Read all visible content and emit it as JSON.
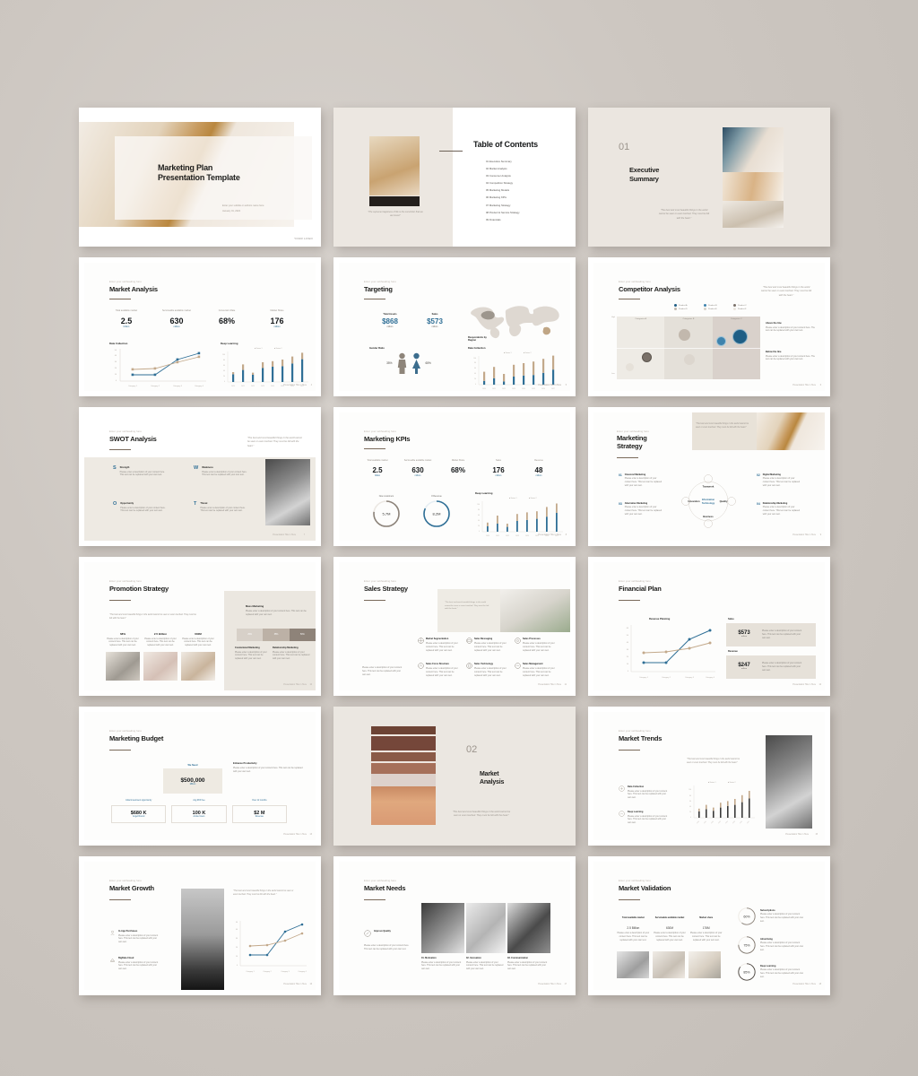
{
  "deck": {
    "eyebrow": "Enter your subheading here",
    "quote": "\"The best and most beautiful things in the world cannot be seen or even touched. They must be felt with the heart.\"",
    "body_placeholder": "Please enter a description of your content here. This text can be replaced with your own text.",
    "footer": "Presentation Title in Here"
  },
  "slides": [
    {
      "id": "cover",
      "title_line1": "Marketing Plan",
      "title_line2": "Presentation Template",
      "subtitle": "Enter your subtitle or authors name here",
      "date": "January 01, 2022",
      "logo": "YOUR LOGO"
    },
    {
      "id": "table-of-contents",
      "title": "Table of Contents",
      "caption": "\"The supreme happiness of life is the conviction that we are loved.\"",
      "items": [
        "01  Executive Summary",
        "02  Market Analysis",
        "03  Consumer Analysis",
        "04  Competition Strategy",
        "05  Marketing Models",
        "06  Marketing KPIs",
        "07  Marketing Strategy",
        "08  Product & Service Strategy",
        "09  Financials"
      ]
    },
    {
      "id": "section-01",
      "number": "01",
      "title_line1": "Executive",
      "title_line2": "Summary"
    },
    {
      "id": "market-analysis",
      "title": "Market Analysis",
      "stats": [
        {
          "label": "Total available market",
          "value": "2.5",
          "unit": "billion"
        },
        {
          "label": "Serviceable available market",
          "value": "630",
          "unit": "million"
        },
        {
          "label": "Conversion Rate",
          "value": "68%",
          "unit": ""
        },
        {
          "label": "Market Share",
          "value": "176",
          "unit": "million"
        }
      ],
      "chart_left_title": "Data Collection",
      "chart_right_title": "Deep Learning",
      "page": "4"
    },
    {
      "id": "targeting",
      "title": "Targeting",
      "stats": [
        {
          "label": "Total Assets",
          "value": "$868",
          "unit": "million"
        },
        {
          "label": "Sales",
          "value": "$573",
          "unit": "million"
        }
      ],
      "gender_label": "Gender Ratio",
      "gender_male": "35%",
      "gender_female": "65%",
      "map_label": "Respondents by Region",
      "chart_title": "Data Collection",
      "page": "5"
    },
    {
      "id": "competitor-analysis",
      "title": "Competitor Analysis",
      "legend": [
        "Product A",
        "Product B",
        "Product C",
        "Product D",
        "Product E",
        "Product F"
      ],
      "columns": [
        "Categories A",
        "Categories B",
        "Categories C"
      ],
      "axis_high": "High",
      "axis_low": "Low",
      "notes": [
        {
          "heading": "Above the line",
          "text": "Please enter a description of your content here. The text can be replaced with your own text."
        },
        {
          "heading": "Below the line",
          "text": "Please enter a description of your content here. The text can be replaced with your own text."
        }
      ],
      "page": "6"
    },
    {
      "id": "swot-analysis",
      "title": "SWOT Analysis",
      "cells": [
        {
          "letter": "S",
          "heading": "Strength"
        },
        {
          "letter": "W",
          "heading": "Weakness"
        },
        {
          "letter": "O",
          "heading": "Opportunity"
        },
        {
          "letter": "T",
          "heading": "Threat"
        }
      ],
      "page": "7"
    },
    {
      "id": "marketing-kpis",
      "title": "Marketing KPIs",
      "stats": [
        {
          "label": "Total available market",
          "value": "2.5",
          "unit": "billion"
        },
        {
          "label": "Serviceable available market",
          "value": "630",
          "unit": "million"
        },
        {
          "label": "Market Share",
          "value": "68%",
          "unit": ""
        },
        {
          "label": "Sales",
          "value": "176",
          "unit": "million"
        },
        {
          "label": "Revenue",
          "value": "48",
          "unit": "million"
        }
      ],
      "donuts": [
        {
          "label": "New customers",
          "value": "5,7M"
        },
        {
          "label": "# Revenue",
          "value": "8,2M"
        }
      ],
      "chart_title": "Deep Learning",
      "page": "8"
    },
    {
      "id": "marketing-strategy",
      "title_line1": "Marketing",
      "title_line2": "Strategy",
      "items": [
        {
          "num": "01",
          "heading": "Classical Marketing"
        },
        {
          "num": "02",
          "heading": "Digital Marketing"
        },
        {
          "num": "03",
          "heading": "Alternative Marketing"
        },
        {
          "num": "04",
          "heading": "Relationship Marketing"
        }
      ],
      "center": "Information Technology",
      "ring": [
        "Teamwork",
        "Quality",
        "Business",
        "Innovation"
      ],
      "page": "9"
    },
    {
      "id": "promotion-strategy",
      "title": "Promotion Strategy",
      "stats": [
        {
          "value": "68%"
        },
        {
          "value": "2.5 Billion"
        },
        {
          "value": "630M"
        }
      ],
      "panel_heading": "Mass Marketing",
      "bars": [
        "25%",
        "35%",
        "50%"
      ],
      "panel_items": [
        "Customized Marketing",
        "Relationship Marketing"
      ],
      "page": "10"
    },
    {
      "id": "sales-strategy",
      "title": "Sales Strategy",
      "items": [
        "Market Segmentation",
        "Sales Messaging",
        "Sales Processes",
        "Sales Force Structure",
        "Sales Technology",
        "Sales Management"
      ],
      "page": "11"
    },
    {
      "id": "financial-plan",
      "title": "Financial Plan",
      "chart_title": "Revenue Planning",
      "cards": [
        {
          "label": "Sales",
          "value": "$573",
          "unit": "million"
        },
        {
          "label": "Revenue",
          "value": "$247",
          "unit": "million"
        }
      ],
      "page": "12"
    },
    {
      "id": "marketing-budget",
      "title": "Marketing Budget",
      "need_label": "We Need",
      "need_value": "$500,000",
      "need_unit": "Million",
      "note_heading": "Enhance Productivity",
      "cards": [
        {
          "label": "Initial investment opportunity",
          "value": "$680 K",
          "unit": "Angel Round"
        },
        {
          "label": "Avg ROI free",
          "value": "100 K",
          "unit": "Active Users"
        },
        {
          "label": "Over 12 months",
          "value": "$2 M",
          "unit": "Revenue"
        }
      ],
      "page": "13"
    },
    {
      "id": "section-02",
      "number": "02",
      "title_line1": "Market",
      "title_line2": "Analysis"
    },
    {
      "id": "market-trends",
      "title": "Market Trends",
      "items": [
        {
          "heading": "Data Collection"
        },
        {
          "heading": "Deep Learning"
        }
      ],
      "legend": [
        "Series 1",
        "Series 2"
      ],
      "page": "15"
    },
    {
      "id": "market-growth",
      "title": "Market Growth",
      "items": [
        {
          "heading": "In-App Purchases"
        },
        {
          "heading": "BigData Cloud"
        }
      ],
      "page": "16"
    },
    {
      "id": "market-needs",
      "title": "Market Needs",
      "side_heading": "Improve Quality",
      "items": [
        "01. Motivation",
        "02. Innovation",
        "03. Communication"
      ],
      "page": "17"
    },
    {
      "id": "market-validation",
      "title": "Market Validation",
      "stats": [
        {
          "label": "Total available market",
          "value": "2.5 Billion"
        },
        {
          "label": "Serviceable available market",
          "value": "630M"
        },
        {
          "label": "Market share",
          "value": "176M"
        }
      ],
      "donuts": [
        {
          "value": "60%",
          "heading": "Subscriptions"
        },
        {
          "value": "75%",
          "heading": "Advertising"
        },
        {
          "value": "85%",
          "heading": "Deep Learning"
        }
      ],
      "page": "18"
    }
  ],
  "chart_data": [
    {
      "type": "line",
      "title": "Data Collection",
      "slide": "market-analysis",
      "categories": [
        "Category 1",
        "Category 2",
        "Category 3",
        "Category 4"
      ],
      "series": [
        {
          "name": "Series 1",
          "values": [
            10,
            10,
            35,
            47
          ],
          "color": "#2f6f96"
        },
        {
          "name": "Series 2",
          "values": [
            18,
            19,
            30,
            38
          ],
          "color": "#c3a98b"
        }
      ],
      "ylim": [
        0,
        50
      ],
      "grid": false
    },
    {
      "type": "bar",
      "title": "Deep Learning",
      "slide": "market-analysis",
      "categories": [
        "2020",
        "2021",
        "2022",
        "2023",
        "2024",
        "2025",
        "2026",
        "2027"
      ],
      "series": [
        {
          "name": "Series 1",
          "values": [
            22,
            38,
            20,
            45,
            50,
            52,
            62,
            78
          ],
          "color": "#2f6f96"
        },
        {
          "name": "Series 2",
          "values": [
            30,
            52,
            28,
            60,
            64,
            70,
            85,
            100
          ],
          "color": "#c3a98b"
        }
      ],
      "ylim": [
        0,
        120
      ],
      "grid": false,
      "legend": "top"
    },
    {
      "type": "bar",
      "title": "Data Collection",
      "slide": "targeting",
      "categories": [
        "2020",
        "2021",
        "2022",
        "2023",
        "2024",
        "2025",
        "2026",
        "2027"
      ],
      "series": [
        {
          "name": "Series 1",
          "values": [
            14,
            24,
            12,
            30,
            34,
            36,
            44,
            56
          ],
          "color": "#2f6f96"
        },
        {
          "name": "Series 2",
          "values": [
            48,
            66,
            40,
            74,
            80,
            86,
            96,
            112
          ],
          "color": "#c3a98b"
        }
      ],
      "ylim": [
        0,
        120
      ],
      "grid": false,
      "legend": "top"
    },
    {
      "type": "scatter",
      "title": "Competitor Analysis Matrix",
      "slide": "competitor-analysis",
      "xlabel": "Low → High",
      "ylabel": "High",
      "points": [
        {
          "name": "Product A",
          "x": 74,
          "y": 66,
          "r": 13,
          "color": "#2a5f82"
        },
        {
          "name": "Product B",
          "x": 62,
          "y": 60,
          "r": 8,
          "color": "#4a86ad"
        },
        {
          "name": "Product C",
          "x": 30,
          "y": 36,
          "r": 7,
          "color": "#8a8075"
        },
        {
          "name": "Product D",
          "x": 38,
          "y": 68,
          "r": 9,
          "color": "#b9afa3"
        },
        {
          "name": "Product E",
          "x": 18,
          "y": 26,
          "r": 7,
          "color": "#e0dbd3"
        },
        {
          "name": "Product F",
          "x": 48,
          "y": 30,
          "r": 8,
          "color": "#ddd7cf"
        }
      ]
    },
    {
      "type": "bar",
      "title": "Deep Learning",
      "slide": "marketing-kpis",
      "categories": [
        "2020",
        "2021",
        "2022",
        "2023",
        "2024",
        "2025",
        "2026",
        "2027"
      ],
      "series": [
        {
          "name": "Series 1",
          "values": [
            20,
            30,
            18,
            40,
            44,
            48,
            56,
            70
          ],
          "color": "#2f6f96"
        },
        {
          "name": "Series 2",
          "values": [
            34,
            60,
            30,
            66,
            72,
            76,
            92,
            105
          ],
          "color": "#c3a98b"
        }
      ],
      "ylim": [
        0,
        120
      ],
      "grid": false,
      "legend": "top"
    },
    {
      "type": "line",
      "title": "Revenue Planning",
      "slide": "financial-plan",
      "categories": [
        "Category 1",
        "Category 2",
        "Category 3",
        "Category 4"
      ],
      "series": [
        {
          "name": "Series 1",
          "values": [
            12,
            12,
            44,
            58
          ],
          "color": "#2f6f96"
        },
        {
          "name": "Series 2",
          "values": [
            26,
            27,
            33,
            42
          ],
          "color": "#c3a98b"
        }
      ],
      "ylim": [
        0,
        70
      ],
      "grid": false
    },
    {
      "type": "bar",
      "title": "Market Trends",
      "slide": "market-trends",
      "categories": [
        "2020",
        "2021",
        "2022",
        "2023",
        "2024",
        "2025",
        "2026",
        "2027"
      ],
      "series": [
        {
          "name": "Series 1",
          "values": [
            24,
            32,
            26,
            38,
            44,
            48,
            58,
            72
          ],
          "color": "#3a3a3a"
        },
        {
          "name": "Series 2",
          "values": [
            34,
            48,
            38,
            56,
            62,
            70,
            84,
            100
          ],
          "color": "#c3a98b"
        }
      ],
      "ylim": [
        0,
        120
      ],
      "grid": false,
      "legend": "top"
    },
    {
      "type": "line",
      "title": "Market Growth",
      "slide": "market-growth",
      "categories": [
        "Category 1",
        "Category 2",
        "Category 3",
        "Category 4"
      ],
      "series": [
        {
          "name": "Series 1",
          "values": [
            12,
            12,
            38,
            46
          ],
          "color": "#2f6f96"
        },
        {
          "name": "Series 2",
          "values": [
            22,
            23,
            28,
            36
          ],
          "color": "#c3a98b"
        }
      ],
      "ylim": [
        0,
        50
      ],
      "grid": false
    },
    {
      "type": "pie",
      "title": "Marketing KPI donuts",
      "slide": "marketing-kpis",
      "labels": [
        "New customers",
        "# Revenue"
      ],
      "values": [
        78,
        82
      ]
    },
    {
      "type": "pie",
      "title": "Market Validation donuts",
      "slide": "market-validation",
      "labels": [
        "Subscriptions",
        "Advertising",
        "Deep Learning"
      ],
      "values": [
        60,
        75,
        85
      ]
    }
  ]
}
